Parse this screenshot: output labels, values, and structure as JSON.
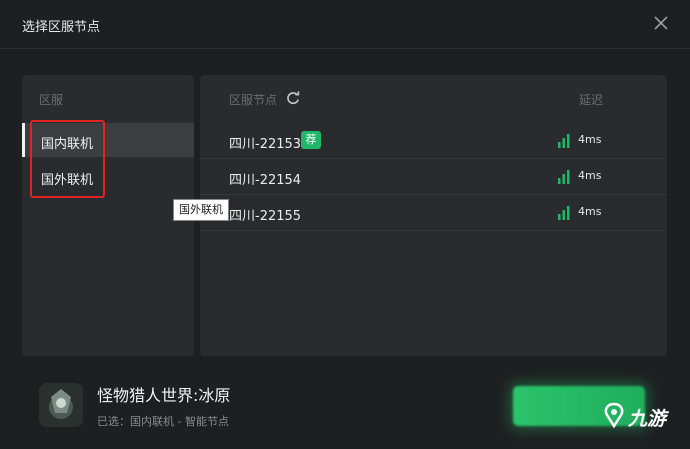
{
  "dialog": {
    "title": "选择区服节点"
  },
  "regions": {
    "header": "区服",
    "items": [
      {
        "label": "国内联机",
        "selected": true
      },
      {
        "label": "国外联机",
        "selected": false
      }
    ],
    "tooltip": "国外联机"
  },
  "nodes": {
    "header": "区服节点",
    "latency_header": "延迟",
    "rows": [
      {
        "name": "四川-22153",
        "badge": "荐",
        "latency": "4ms"
      },
      {
        "name": "四川-22154",
        "latency": "4ms"
      },
      {
        "name": "四川-22155",
        "latency": "4ms"
      }
    ]
  },
  "game": {
    "title": "怪物猎人世界:冰原",
    "selected_info": "已选：国内联机 - 智能节点"
  },
  "watermark": {
    "text": "九游"
  },
  "colors": {
    "accent": "#1fb86a",
    "highlight": "#e02323",
    "background": "#1e1f21",
    "panel": "#2a2b2e"
  }
}
